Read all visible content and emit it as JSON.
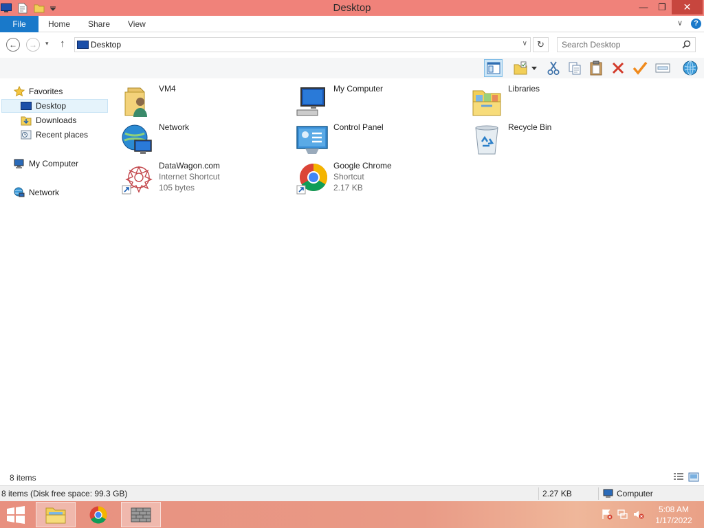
{
  "window": {
    "title": "Desktop",
    "controls": {
      "minimize": "—",
      "maximize": "❐",
      "close": "✕"
    }
  },
  "ribbon": {
    "tabs": [
      {
        "label": "File",
        "icon": ""
      },
      {
        "label": "Home"
      },
      {
        "label": "Share"
      },
      {
        "label": "View"
      }
    ],
    "expand_glyph": "∨",
    "help_glyph": "?"
  },
  "address": {
    "location": "Desktop",
    "search_placeholder": "Search Desktop",
    "back_glyph": "←",
    "forward_glyph": "→",
    "up_glyph": "↑",
    "refresh_glyph": "↻",
    "dropdown_glyph": "∨",
    "recent_glyph": "▾"
  },
  "toolbar": {
    "buttons": [
      "preview-pane",
      "new-folder",
      "cut",
      "copy",
      "paste",
      "delete",
      "properties",
      "rename",
      "internet"
    ]
  },
  "navigation": {
    "favorites_label": "Favorites",
    "items": [
      {
        "label": "Desktop",
        "icon": "desktop-icon"
      },
      {
        "label": "Downloads",
        "icon": "downloads-icon"
      },
      {
        "label": "Recent places",
        "icon": "recent-places-icon"
      }
    ],
    "computer_label": "My Computer",
    "network_label": "Network"
  },
  "content": {
    "items": [
      {
        "name": "VM4",
        "icon": "user-folder-icon"
      },
      {
        "name": "My Computer",
        "icon": "computer-icon"
      },
      {
        "name": "Libraries",
        "icon": "libraries-icon"
      },
      {
        "name": "Network",
        "icon": "network-icon"
      },
      {
        "name": "Control Panel",
        "icon": "control-panel-icon"
      },
      {
        "name": "Recycle Bin",
        "icon": "recycle-bin-icon"
      },
      {
        "name": "DataWagon.com",
        "type": "Internet Shortcut",
        "size": "105 bytes",
        "icon": "datawagon-icon"
      },
      {
        "name": "Google Chrome",
        "type": "Shortcut",
        "size": "2.17 KB",
        "icon": "chrome-icon"
      }
    ]
  },
  "status": {
    "item_count": "8 items",
    "disk_info": "8 items (Disk free space: 99.3 GB)",
    "selection_size": "2.27 KB",
    "location_label": "Computer"
  },
  "taskbar": {
    "apps": [
      "file-explorer",
      "google-chrome",
      "firewall"
    ],
    "time": "5:08 AM",
    "date": "1/17/2022"
  },
  "colors": {
    "title_bar": "#f0827a",
    "close_button": "#c7463e",
    "file_tab": "#1979ca",
    "taskbar": "#e8907f"
  }
}
